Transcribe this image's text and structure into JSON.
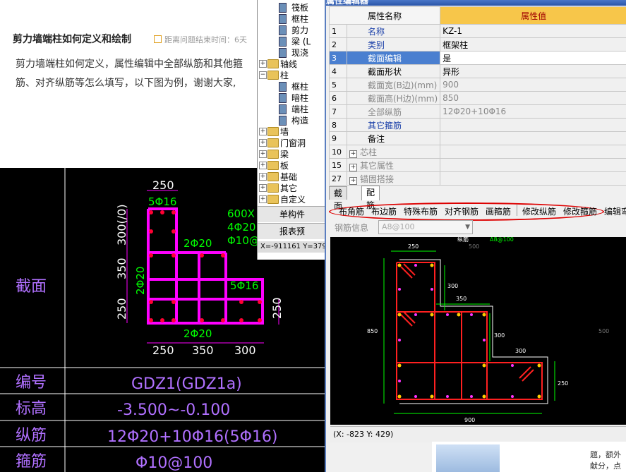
{
  "article": {
    "title": "剪力墙端柱如何定义和绘制",
    "meta": "距离问题结束时间：6天",
    "line1": "剪力墙端柱如何定义，属性编辑中全部纵筋和其他箍",
    "line2": "筋、对齐纵筋等怎么填写，以下图为例，谢谢大家,"
  },
  "cad": {
    "dims_top": [
      "250"
    ],
    "dims_side": [
      "300(/0)",
      "350",
      "250"
    ],
    "dims_bottom": [
      "250",
      "350",
      "300"
    ],
    "dim_right": "250",
    "bar_labels": [
      "5Φ16",
      "2Φ20",
      "2Φ20",
      "5Φ16",
      "2Φ20"
    ],
    "note_lines": [
      "600X",
      "4Φ20",
      "Φ10@"
    ],
    "rows": [
      {
        "label": "截面",
        "value": ""
      },
      {
        "label": "编号",
        "value": "GDZ1(GDZ1a)"
      },
      {
        "label": "标高",
        "value": "-3.500~-0.100"
      },
      {
        "label": "纵筋",
        "value": "12Φ20+10Φ16(5Φ16)"
      },
      {
        "label": "箍筋",
        "value": "Φ10@100"
      }
    ]
  },
  "tree": {
    "items": [
      {
        "label": "筏板",
        "kind": "leaf",
        "indent": 2
      },
      {
        "label": "框柱",
        "kind": "leaf",
        "indent": 2
      },
      {
        "label": "剪力",
        "kind": "leaf",
        "indent": 2
      },
      {
        "label": "梁 (L",
        "kind": "leaf",
        "indent": 2
      },
      {
        "label": "现浇",
        "kind": "leaf",
        "indent": 2
      },
      {
        "label": "轴线",
        "kind": "folder",
        "indent": 1,
        "toggle": "+"
      },
      {
        "label": "柱",
        "kind": "folder",
        "indent": 1,
        "toggle": "−"
      },
      {
        "label": "框柱",
        "kind": "leaf",
        "indent": 2
      },
      {
        "label": "暗柱",
        "kind": "leaf",
        "indent": 2
      },
      {
        "label": "端柱",
        "kind": "leaf",
        "indent": 2
      },
      {
        "label": "构造",
        "kind": "leaf",
        "indent": 2
      },
      {
        "label": "墙",
        "kind": "folder",
        "indent": 1,
        "toggle": "+"
      },
      {
        "label": "门窗洞",
        "kind": "folder",
        "indent": 1,
        "toggle": "+"
      },
      {
        "label": "梁",
        "kind": "folder",
        "indent": 1,
        "toggle": "+"
      },
      {
        "label": "板",
        "kind": "folder",
        "indent": 1,
        "toggle": "+"
      },
      {
        "label": "基础",
        "kind": "folder",
        "indent": 1,
        "toggle": "+"
      },
      {
        "label": "其它",
        "kind": "folder",
        "indent": 1,
        "toggle": "+"
      },
      {
        "label": "自定义",
        "kind": "folder",
        "indent": 1,
        "toggle": "+"
      }
    ],
    "btn_component": "单构件",
    "btn_report": "报表预",
    "coords": "X=-911161 Y=379"
  },
  "props": {
    "window_title": "属性编辑器",
    "header_name": "属性名称",
    "header_value": "属性值",
    "rows": [
      {
        "num": "1",
        "name": "名称",
        "value": "KZ-1",
        "style": "blue"
      },
      {
        "num": "2",
        "name": "类别",
        "value": "框架柱",
        "style": "blue"
      },
      {
        "num": "3",
        "name": "截面编辑",
        "value": "是",
        "style": "sel"
      },
      {
        "num": "4",
        "name": "截面形状",
        "value": "异形",
        "style": "normal"
      },
      {
        "num": "5",
        "name": "截面宽(B边)(mm)",
        "value": "900",
        "style": "grey"
      },
      {
        "num": "6",
        "name": "截面高(H边)(mm)",
        "value": "850",
        "style": "grey"
      },
      {
        "num": "7",
        "name": "全部纵筋",
        "value": "12Φ20+10Φ16",
        "style": "grey"
      },
      {
        "num": "8",
        "name": "其它箍筋",
        "value": "",
        "style": "blue"
      },
      {
        "num": "9",
        "name": "备注",
        "value": "",
        "style": "normal"
      },
      {
        "num": "10",
        "name": "芯柱",
        "value": "",
        "style": "expand"
      },
      {
        "num": "15",
        "name": "其它属性",
        "value": "",
        "style": "expand"
      },
      {
        "num": "27",
        "name": "锚固搭接",
        "value": "",
        "style": "expand"
      }
    ],
    "tabs": [
      "截面",
      "配筋"
    ],
    "toolbar": [
      "布角筋",
      "布边筋",
      "特殊布筋",
      "对齐钢筋",
      "画箍筋",
      "修改纵筋",
      "修改箍筋",
      "编辑弯"
    ],
    "rebar_info_label": "钢筋信息",
    "rebar_info_value": "A8@100",
    "status": "(X: -823 Y: 429)"
  },
  "drawing": {
    "dims": [
      "250",
      "300",
      "350",
      "300",
      "300",
      "850",
      "250",
      "900",
      "500",
      "500"
    ],
    "labels": [
      "纵筋",
      "A8@100"
    ]
  },
  "bottom_web": {
    "line1": "题，额外",
    "line2": "献分，点"
  },
  "colors": {
    "cad_magenta": "#ff00ff",
    "cad_red": "#ff0033",
    "cad_label": "#b070ff",
    "cad_green": "#00ff00",
    "selection_blue": "#4a7fd0",
    "header_gold": "#f7c64a"
  }
}
